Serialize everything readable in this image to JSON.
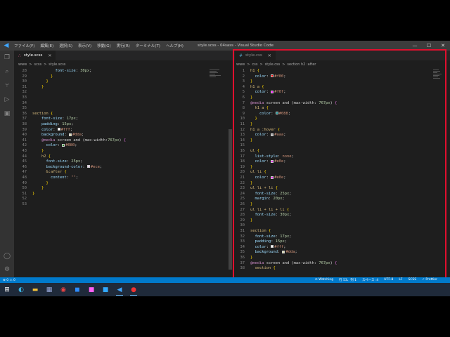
{
  "titlebar": {
    "menu": [
      "ファイル(F)",
      "編集(E)",
      "選択(S)",
      "表示(V)",
      "移動(G)",
      "実行(R)",
      "ターミナル(T)",
      "ヘルプ(H)"
    ],
    "window_title": "style.scss - 04sass - Visual Studio Code",
    "min": "—",
    "max": "☐",
    "close": "✕"
  },
  "left_editor": {
    "tab_label": "style.scss",
    "tab_icon": "∴",
    "breadcrumb": [
      "www",
      ">",
      "scss",
      ">",
      "style.scss"
    ],
    "lines": [
      {
        "n": "28",
        "t": "          font-size: 30px;"
      },
      {
        "n": "29",
        "t": "        }"
      },
      {
        "n": "30",
        "t": "      }"
      },
      {
        "n": "31",
        "t": "    }"
      },
      {
        "n": "32",
        "t": ""
      },
      {
        "n": "33",
        "t": ""
      },
      {
        "n": "34",
        "t": ""
      },
      {
        "n": "35",
        "t": ""
      },
      {
        "n": "36",
        "t": "section {"
      },
      {
        "n": "37",
        "t": "    font-size: 17px;"
      },
      {
        "n": "38",
        "t": "    padding: 15px;"
      },
      {
        "n": "39",
        "t": "    color: #fff;"
      },
      {
        "n": "40",
        "t": "    background: #dda;"
      },
      {
        "n": "41",
        "t": "    @media screen and (max-width:767px) {"
      },
      {
        "n": "42",
        "t": "      color: #080;"
      },
      {
        "n": "43",
        "t": "    }"
      },
      {
        "n": "44",
        "t": "    h2 {"
      },
      {
        "n": "45",
        "t": "      font-size: 25px;"
      },
      {
        "n": "46",
        "t": "      background-color: #ece;"
      },
      {
        "n": "47",
        "t": "      &:after {"
      },
      {
        "n": "48",
        "t": "        content: \"\";"
      },
      {
        "n": "49",
        "t": "      }"
      },
      {
        "n": "50",
        "t": "    }"
      },
      {
        "n": "51",
        "t": "}"
      },
      {
        "n": "52",
        "t": ""
      },
      {
        "n": "53",
        "t": ""
      }
    ]
  },
  "right_editor": {
    "tab_label": "style.css",
    "tab_icon": "#",
    "breadcrumb": [
      "www",
      ">",
      "css",
      ">",
      "style.css",
      ">",
      "section h2 :after"
    ],
    "lines": [
      {
        "n": "1",
        "t": "h1 {"
      },
      {
        "n": "2",
        "t": "  color: #f00;"
      },
      {
        "n": "3",
        "t": "}"
      },
      {
        "n": "4",
        "t": "h1 a {"
      },
      {
        "n": "5",
        "t": "  color: #f0f;"
      },
      {
        "n": "6",
        "t": "}"
      },
      {
        "n": "7",
        "t": "@media screen and (max-width: 767px) {"
      },
      {
        "n": "8",
        "t": "  h1 a {"
      },
      {
        "n": "9",
        "t": "    color: #088;"
      },
      {
        "n": "10",
        "t": "  }"
      },
      {
        "n": "11",
        "t": "}"
      },
      {
        "n": "12",
        "t": "h1 a :hover {"
      },
      {
        "n": "13",
        "t": "  color: #aaa;"
      },
      {
        "n": "14",
        "t": "}"
      },
      {
        "n": "15",
        "t": ""
      },
      {
        "n": "16",
        "t": "ul {"
      },
      {
        "n": "17",
        "t": "  list-style: none;"
      },
      {
        "n": "18",
        "t": "  color: #e0e;"
      },
      {
        "n": "19",
        "t": "}"
      },
      {
        "n": "20",
        "t": "ul li {"
      },
      {
        "n": "21",
        "t": "  color: #e0e;"
      },
      {
        "n": "22",
        "t": "}"
      },
      {
        "n": "23",
        "t": "ul li + li {"
      },
      {
        "n": "24",
        "t": "  font-size: 25px;"
      },
      {
        "n": "25",
        "t": "  margin: 20px;"
      },
      {
        "n": "26",
        "t": "}"
      },
      {
        "n": "27",
        "t": "ul li + li + li {"
      },
      {
        "n": "28",
        "t": "  font-size: 30px;"
      },
      {
        "n": "29",
        "t": "}"
      },
      {
        "n": "30",
        "t": ""
      },
      {
        "n": "31",
        "t": "section {"
      },
      {
        "n": "32",
        "t": "  font-size: 17px;"
      },
      {
        "n": "33",
        "t": "  padding: 15px;"
      },
      {
        "n": "34",
        "t": "  color: #fff;"
      },
      {
        "n": "35",
        "t": "  background: #dda;"
      },
      {
        "n": "36",
        "t": "}"
      },
      {
        "n": "37",
        "t": "@media screen and (max-width: 767px) {"
      },
      {
        "n": "38",
        "t": "  section {"
      }
    ]
  },
  "statusbar": {
    "left": [
      "⊗ 0 ⚠ 0"
    ],
    "right": [
      "⊙ Watching",
      "行 53、列 1",
      "スペース: 4",
      "UTF-8",
      "LF",
      "SCSS",
      "✓ Prettier"
    ]
  },
  "taskbar": {
    "icons": [
      "windows-start-icon",
      "edge-icon",
      "explorer-icon",
      "photos-icon",
      "chrome-icon",
      "zoom-icon",
      "xd-icon",
      "photoshop-icon",
      "vscode-icon",
      "app-icon"
    ]
  },
  "colors": {
    "accent": "#007acc",
    "highlight_frame": "#e0102e"
  }
}
